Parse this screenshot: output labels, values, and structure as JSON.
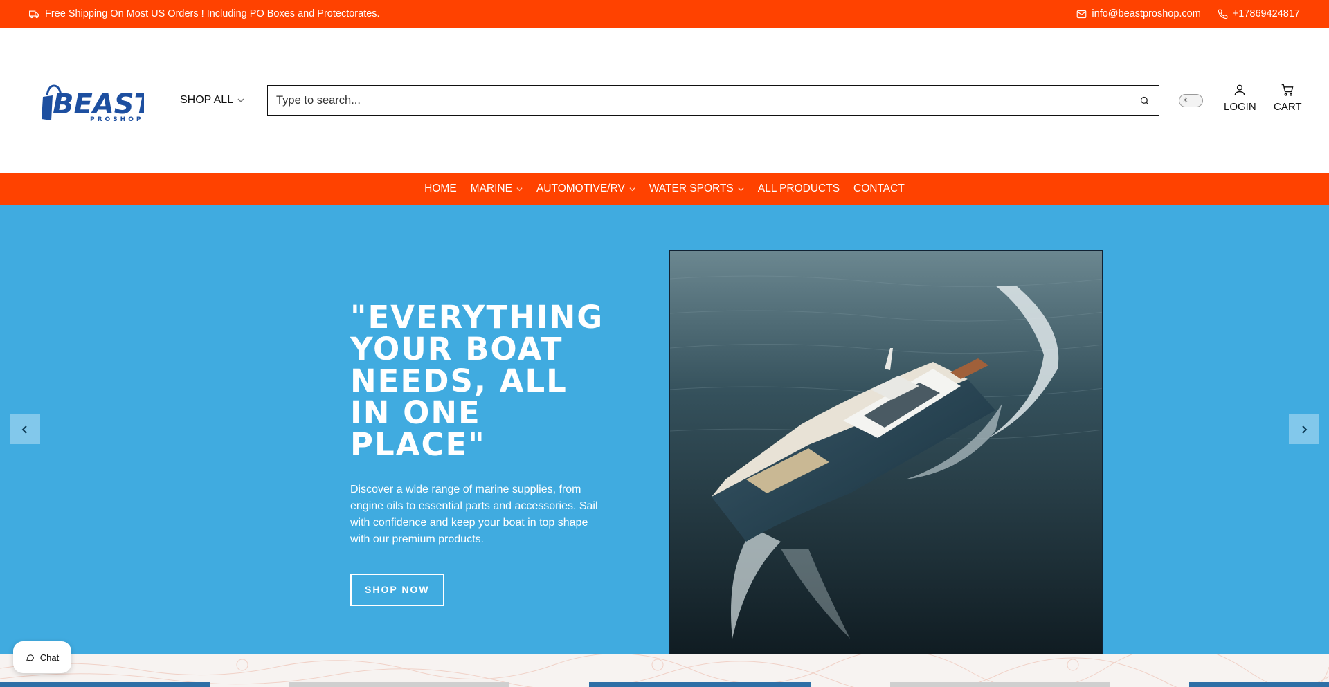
{
  "announcement": {
    "shipping_text": "Free Shipping On Most US Orders ! Including PO Boxes and Protectorates.",
    "email": "info@beastproshop.com",
    "phone": "+17869424817"
  },
  "logo": {
    "main": "BEAST",
    "sub": "PROSHOP"
  },
  "header": {
    "shop_all_label": "SHOP ALL",
    "search_placeholder": "Type to search...",
    "login_label": "LOGIN",
    "cart_label": "CART"
  },
  "nav": {
    "items": [
      {
        "label": "HOME"
      },
      {
        "label": "MARINE"
      },
      {
        "label": "AUTOMOTIVE/RV"
      },
      {
        "label": "WATER SPORTS"
      },
      {
        "label": "ALL PRODUCTS"
      },
      {
        "label": "CONTACT"
      }
    ]
  },
  "hero": {
    "title": "\"EVERYTHING YOUR BOAT NEEDS, ALL IN ONE PLACE\"",
    "description": "Discover a wide range of marine supplies, from engine oils to essential parts and accessories. Sail with confidence and keep your boat in top shape with our premium products.",
    "cta_label": "SHOP NOW"
  },
  "chat": {
    "label": "Chat"
  },
  "colors": {
    "brand_orange": "#ff4200",
    "hero_blue": "#40abe0",
    "logo_blue": "#1d4fa0"
  },
  "icons": [
    "truck-icon",
    "mail-icon",
    "phone-icon",
    "chevron-down-icon",
    "search-icon",
    "sun-icon",
    "user-icon",
    "cart-icon",
    "chevron-left-icon",
    "chevron-right-icon",
    "chat-icon"
  ]
}
